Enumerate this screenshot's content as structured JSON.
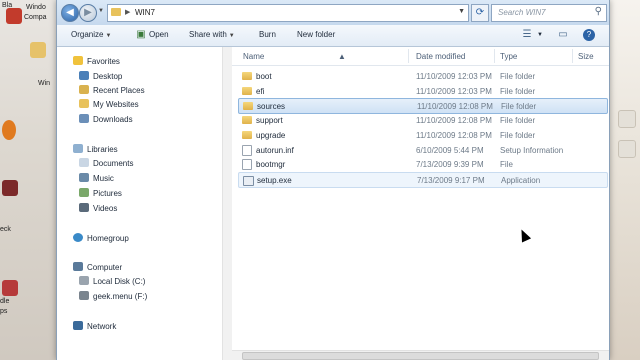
{
  "window": {
    "path": "WIN7",
    "search_placeholder": "Search WIN7"
  },
  "desktop": {
    "labels": [
      "Bla",
      "Windo",
      "Compa",
      "Win",
      "eck",
      "dle",
      "ps"
    ]
  },
  "toolbar": {
    "organize": "Organize",
    "open": "Open",
    "share_with": "Share with",
    "burn": "Burn",
    "new_folder": "New folder"
  },
  "nav": {
    "favorites": "Favorites",
    "desktop": "Desktop",
    "recent_places": "Recent Places",
    "my_websites": "My Websites",
    "downloads": "Downloads",
    "libraries": "Libraries",
    "documents": "Documents",
    "music": "Music",
    "pictures": "Pictures",
    "videos": "Videos",
    "homegroup": "Homegroup",
    "computer": "Computer",
    "local_disk": "Local Disk (C:)",
    "geek_menu": "geek.menu (F:)",
    "network": "Network"
  },
  "columns": {
    "name": "Name",
    "date": "Date modified",
    "type": "Type",
    "size": "Size"
  },
  "files": [
    {
      "name": "boot",
      "date": "11/10/2009 12:03 PM",
      "type": "File folder",
      "kind": "folder"
    },
    {
      "name": "efi",
      "date": "11/10/2009 12:03 PM",
      "type": "File folder",
      "kind": "folder"
    },
    {
      "name": "sources",
      "date": "11/10/2009 12:08 PM",
      "type": "File folder",
      "kind": "folder"
    },
    {
      "name": "support",
      "date": "11/10/2009 12:08 PM",
      "type": "File folder",
      "kind": "folder"
    },
    {
      "name": "upgrade",
      "date": "11/10/2009 12:08 PM",
      "type": "File folder",
      "kind": "folder"
    },
    {
      "name": "autorun.inf",
      "date": "6/10/2009 5:44 PM",
      "type": "Setup Information",
      "kind": "file"
    },
    {
      "name": "bootmgr",
      "date": "7/13/2009 9:39 PM",
      "type": "File",
      "kind": "file"
    },
    {
      "name": "setup.exe",
      "date": "7/13/2009 9:17 PM",
      "type": "Application",
      "kind": "app"
    }
  ],
  "colors": {
    "selected": "#cfe2f5",
    "accent": "#2c63a6",
    "folder": "#e0b24a"
  }
}
